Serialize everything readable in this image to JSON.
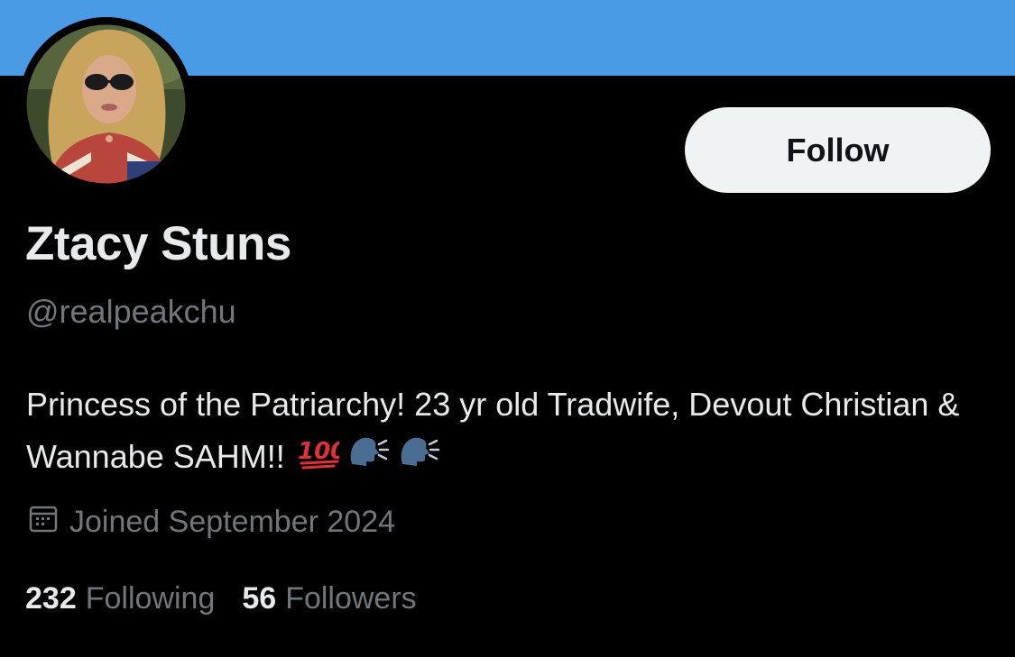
{
  "colors": {
    "banner": "#4a9be6",
    "background": "#000000",
    "primary_text": "#e7e9ea",
    "secondary_text": "#71767b",
    "follow_button_bg": "#eff3f4"
  },
  "profile": {
    "display_name": "Ztacy Stuns",
    "handle": "@realpeakchu",
    "bio_text": "Princess of the Patriarchy! 23 yr old Tradwife, Devout Christian & Wannabe SAHM!!",
    "bio_emojis": [
      "💯",
      "🗣",
      "🗣"
    ],
    "joined_icon": "calendar-icon",
    "joined": "Joined September 2024"
  },
  "actions": {
    "follow_label": "Follow"
  },
  "stats": {
    "following_count": "232",
    "following_label": "Following",
    "followers_count": "56",
    "followers_label": "Followers"
  }
}
